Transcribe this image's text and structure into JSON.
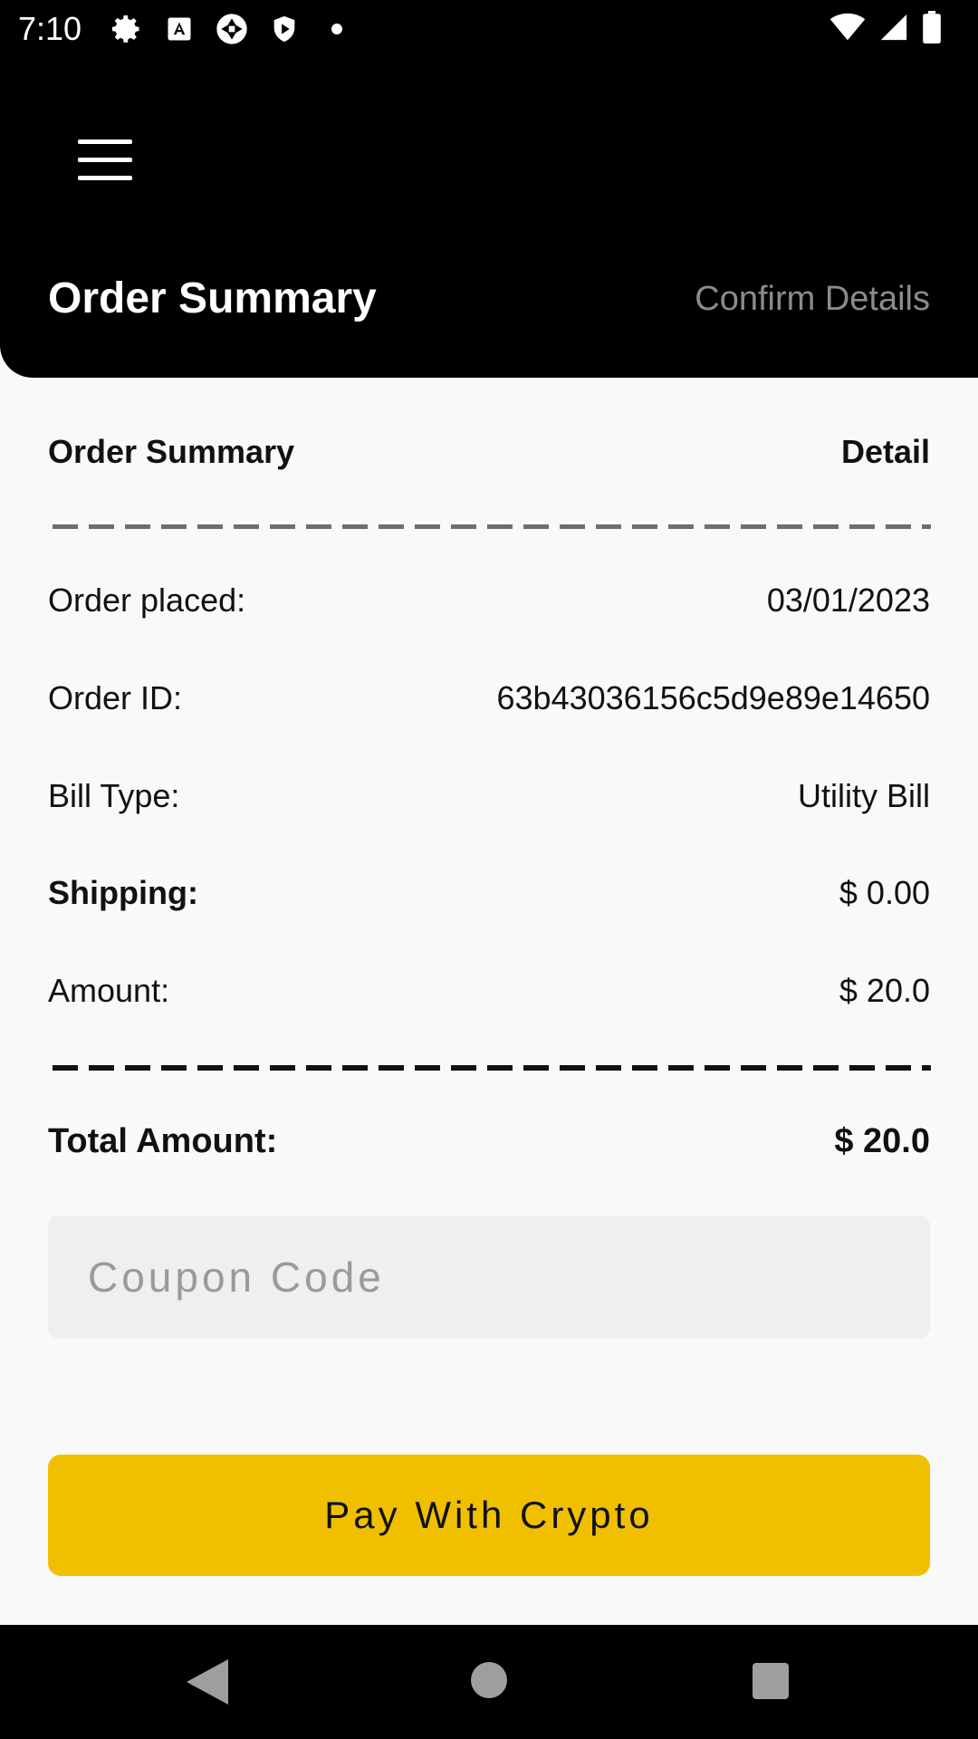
{
  "status_bar": {
    "time": "7:10",
    "left_icons": [
      "gear-icon",
      "font-a-icon",
      "camera-shutter-icon",
      "shield-play-icon",
      "dot-icon"
    ],
    "right_icons": [
      "wifi-icon",
      "cell-signal-icon",
      "battery-icon"
    ]
  },
  "app_bar": {
    "menu_icon": "hamburger-menu-icon",
    "title": "Order Summary",
    "subtitle": "Confirm Details"
  },
  "summary": {
    "header_label": "Order Summary",
    "header_value": "Detail",
    "rows": [
      {
        "label": "Order placed:",
        "value": "03/01/2023"
      },
      {
        "label": "Order ID:",
        "value": "63b43036156c5d9e89e14650"
      },
      {
        "label": "Bill Type:",
        "value": "Utility Bill"
      },
      {
        "label": "Shipping:",
        "value": "$ 0.00"
      },
      {
        "label": "Amount:",
        "value": "$ 20.0"
      }
    ],
    "total_label": "Total Amount:",
    "total_value": "$ 20.0"
  },
  "coupon": {
    "placeholder": "Coupon Code",
    "value": ""
  },
  "pay_button": {
    "label": "Pay With Crypto"
  },
  "colors": {
    "header_bg": "#000000",
    "page_bg": "#f9f9f9",
    "accent": "#f0c000",
    "subtitle": "#8b8b8b",
    "input_bg": "#efefef"
  },
  "nav_bar": {
    "buttons": [
      "back-triangle-icon",
      "home-circle-icon",
      "recents-square-icon"
    ]
  }
}
